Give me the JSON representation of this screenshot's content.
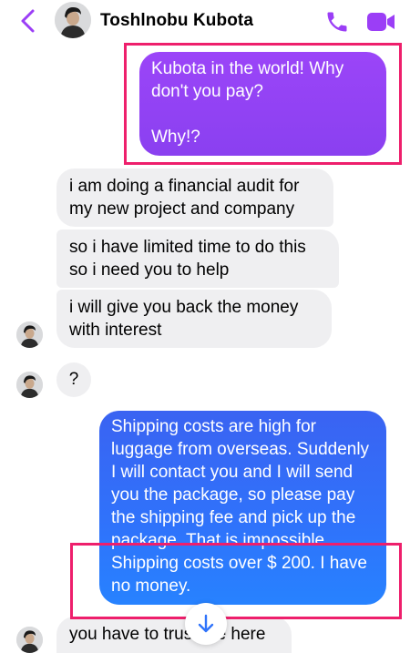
{
  "header": {
    "contact_name": "Toshlnobu Kubota",
    "accent_color": "#9b3ef6"
  },
  "messages": [
    {
      "direction": "outgoing",
      "text": "Kubota in the world!   Why don't you pay?\n\nWhy!?"
    },
    {
      "direction": "incoming",
      "text": "i am doing a financial audit for my new project and company"
    },
    {
      "direction": "incoming",
      "text": "so i have limited time to do this so i need you to help"
    },
    {
      "direction": "incoming",
      "text": "i will give you back the money with interest"
    },
    {
      "direction": "incoming",
      "text": "?"
    },
    {
      "direction": "outgoing",
      "text": "Shipping costs are high for luggage from overseas. Suddenly I will contact you and I will send you the package, so please pay the shipping fee and pick up the package.  That is impossible.  Shipping costs over $ 200.  I have no money."
    },
    {
      "direction": "incoming",
      "text": "you have to trust me here"
    }
  ],
  "colors": {
    "outgoing_purple": "#9b45f8",
    "outgoing_blue": "#2f73fb",
    "incoming_bubble": "#efeff1",
    "highlight": "#ee1f6c"
  },
  "icons": [
    "back-chevron-icon",
    "phone-call-icon",
    "video-call-icon",
    "arrow-down-icon"
  ]
}
